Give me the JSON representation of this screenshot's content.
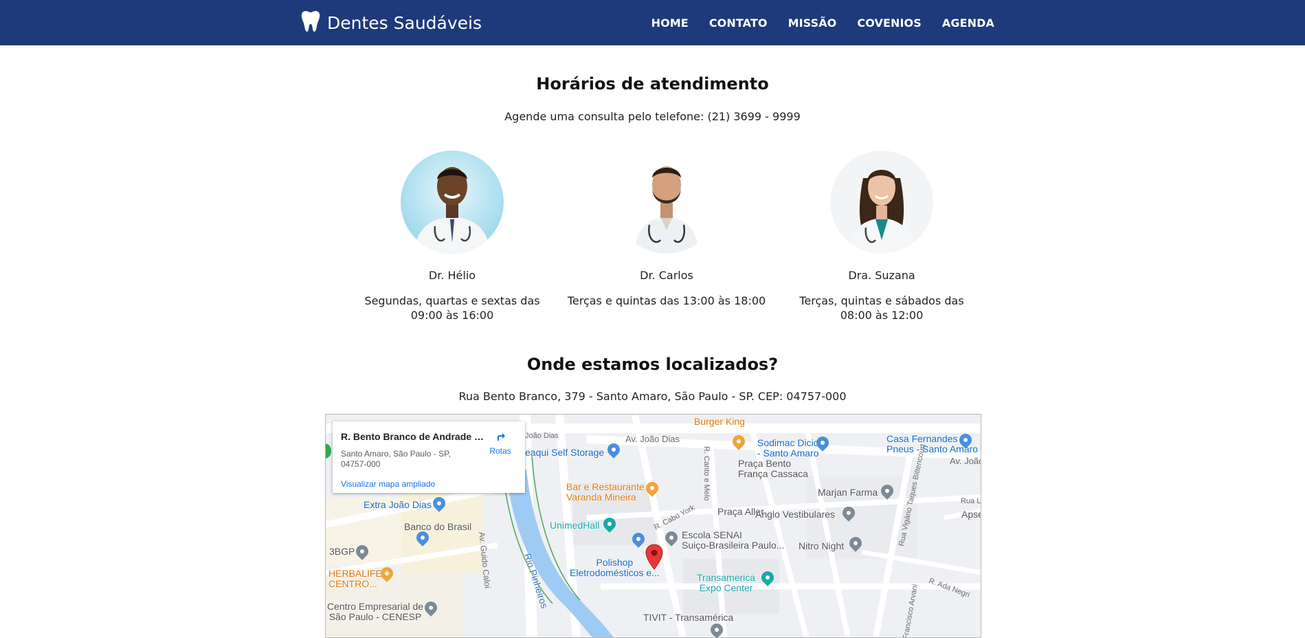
{
  "brand": {
    "name": "Dentes Saudáveis",
    "icon": "tooth-icon"
  },
  "nav": {
    "items": [
      {
        "label": "HOME"
      },
      {
        "label": "CONTATO"
      },
      {
        "label": "MISSÃO"
      },
      {
        "label": "COVENIOS"
      },
      {
        "label": "AGENDA"
      }
    ]
  },
  "schedule": {
    "title": "Horários de atendimento",
    "subtitle": "Agende uma consulta pelo telefone: (21) 3699 - 9999",
    "doctors": [
      {
        "name": "Dr. Hélio",
        "hours": "Segundas, quartas e sextas das 09:00 às 16:00"
      },
      {
        "name": "Dr. Carlos",
        "hours": "Terças e quintas das 13:00 às 18:00"
      },
      {
        "name": "Dra. Suzana",
        "hours": "Terças, quintas e sábados das 08:00 às 12:00"
      }
    ]
  },
  "location": {
    "title": "Onde estamos localizados?",
    "address": "Rua Bento Branco, 379 - Santo Amaro, São Paulo - SP. CEP: 04757-000"
  },
  "map": {
    "card": {
      "title": "R. Bento Branco de Andrade Fi...",
      "address": "Santo Amaro, São Paulo - SP, 04757-000",
      "link": "Visualizar mapa ampliado",
      "route": "Rotas"
    },
    "places": {
      "burger_king": "Burger King",
      "sodimac": "Sodimac Dicico\n- Santo Amaro",
      "casa_fernandes": "Casa Fernandes\nPneus - Santo Amaro",
      "self_storage": "eaqui Self Storage",
      "praca_bento": "Praça Bento\nFrança Cassaca",
      "bar_restaurante": "Bar e Restaurante\nVaranda Mineira",
      "marjan": "Marjan Farma",
      "extra": "Extra João Dias",
      "praca_aller": "Praça Aller",
      "anglo": "Anglo Vestibulares",
      "apsen": "Apsen F",
      "banco_brasil": "Banco do Brasil",
      "unimed": "UnimedHall",
      "senai": "Escola SENAI\nSuiço-Brasileira Paulo...",
      "nitro": "Nitro Night",
      "bgp": "3BGP",
      "polishop": "Polishop\nEletrodomésticos e...",
      "herbalife": "HERBALIFE\nCENTRO...",
      "transamerica": "Transamerica\nExpo Center",
      "cenesp": "Centro Empresarial de\nSão Paulo - CENESP",
      "tivit": "TIVIT - Transamérica",
      "rio": "Rio Pinheiros"
    },
    "streets": {
      "joao_dias_1": "João Dias",
      "joao_dias_2": "Av. João Dias",
      "joao_dias_3": "Av. João",
      "canto_melo": "R. Canto e Melo",
      "cabo_york": "R. Cabo York",
      "guido_caloi": "Av. Guido Caloi",
      "vigario": "Rua Vigário Taques Bittencourt",
      "ada_negri": "R. Ada Negri",
      "rua_lu": "Rua Lu",
      "francisco": "Francisco Arvani"
    }
  },
  "colors": {
    "navbar": "#1e3a7b",
    "text": "#222222",
    "link": "#1a73e8",
    "marker": "#e53935"
  }
}
